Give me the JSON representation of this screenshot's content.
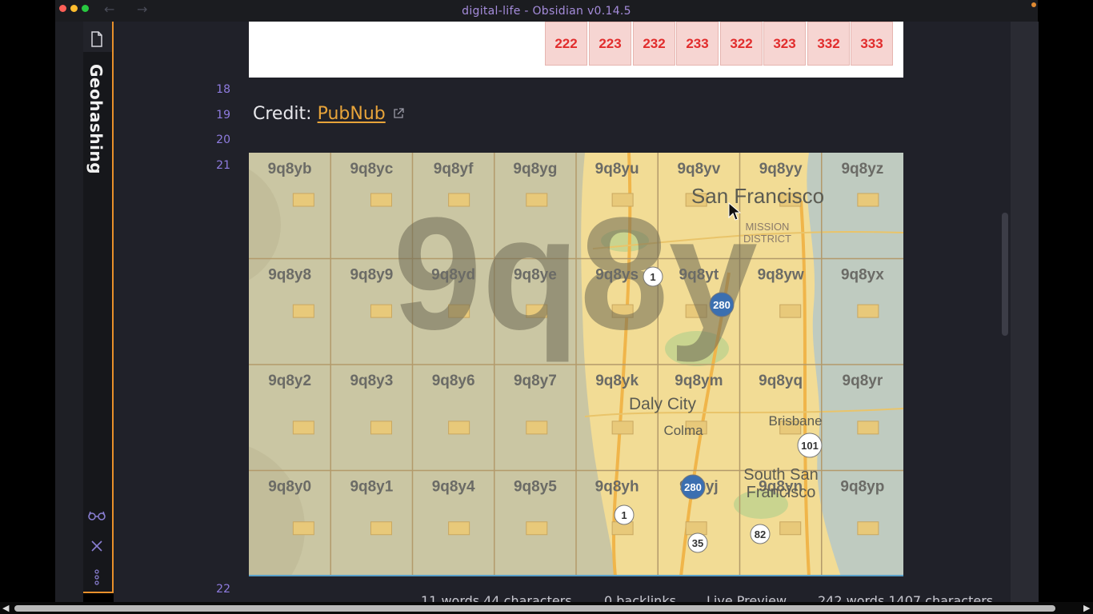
{
  "window": {
    "title": "digital-life - Obsidian v0.14.5",
    "back_arrow": "←",
    "forward_arrow": "→"
  },
  "sidebar": {
    "pane_title": "Geohashing",
    "icons": [
      "file-icon",
      "glasses-icon",
      "close-icon",
      "more-icon"
    ]
  },
  "editor": {
    "line_numbers": [
      "18",
      "19",
      "20",
      "21",
      "22"
    ],
    "table_cells": [
      "222",
      "223",
      "232",
      "233",
      "322",
      "323",
      "332",
      "333"
    ],
    "credit": {
      "prefix": "Credit: ",
      "link_text": "PubNub",
      "link_icon": "external-link-icon"
    },
    "map": {
      "watermark": "9q8y",
      "grid_labels": [
        [
          "9q8yb",
          "9q8yc",
          "9q8yf",
          "9q8yg",
          "9q8yu",
          "9q8yv",
          "9q8yy",
          "9q8yz"
        ],
        [
          "9q8y8",
          "9q8y9",
          "9q8yd",
          "9q8ye",
          "9q8ys",
          "9q8yt",
          "9q8yw",
          "9q8yx"
        ],
        [
          "9q8y2",
          "9q8y3",
          "9q8y6",
          "9q8y7",
          "9q8yk",
          "9q8ym",
          "9q8yq",
          "9q8yr"
        ],
        [
          "9q8y0",
          "9q8y1",
          "9q8y4",
          "9q8y5",
          "9q8yh",
          "9q8yj",
          "9q8yn",
          "9q8yp"
        ]
      ],
      "places": [
        {
          "text": "San Francisco"
        },
        {
          "text": "MISSION"
        },
        {
          "text": "DISTRICT"
        },
        {
          "text": "Daly City"
        },
        {
          "text": "Colma"
        },
        {
          "text": "Brisbane"
        },
        {
          "text": "South San"
        },
        {
          "text": "Francisco"
        }
      ],
      "route_shields": [
        "1",
        "280",
        "101",
        "280",
        "1",
        "35",
        "82"
      ]
    }
  },
  "status_bar": {
    "selection_count": "11 words 44 characters",
    "backlinks": "0 backlinks",
    "mode": "Live Preview",
    "doc_count": "242 words 1407 characters"
  },
  "colors": {
    "accent": "#e8902b",
    "link": "#e8a43a",
    "line_number": "#8f7ce0",
    "table_text": "#e12c2c"
  }
}
